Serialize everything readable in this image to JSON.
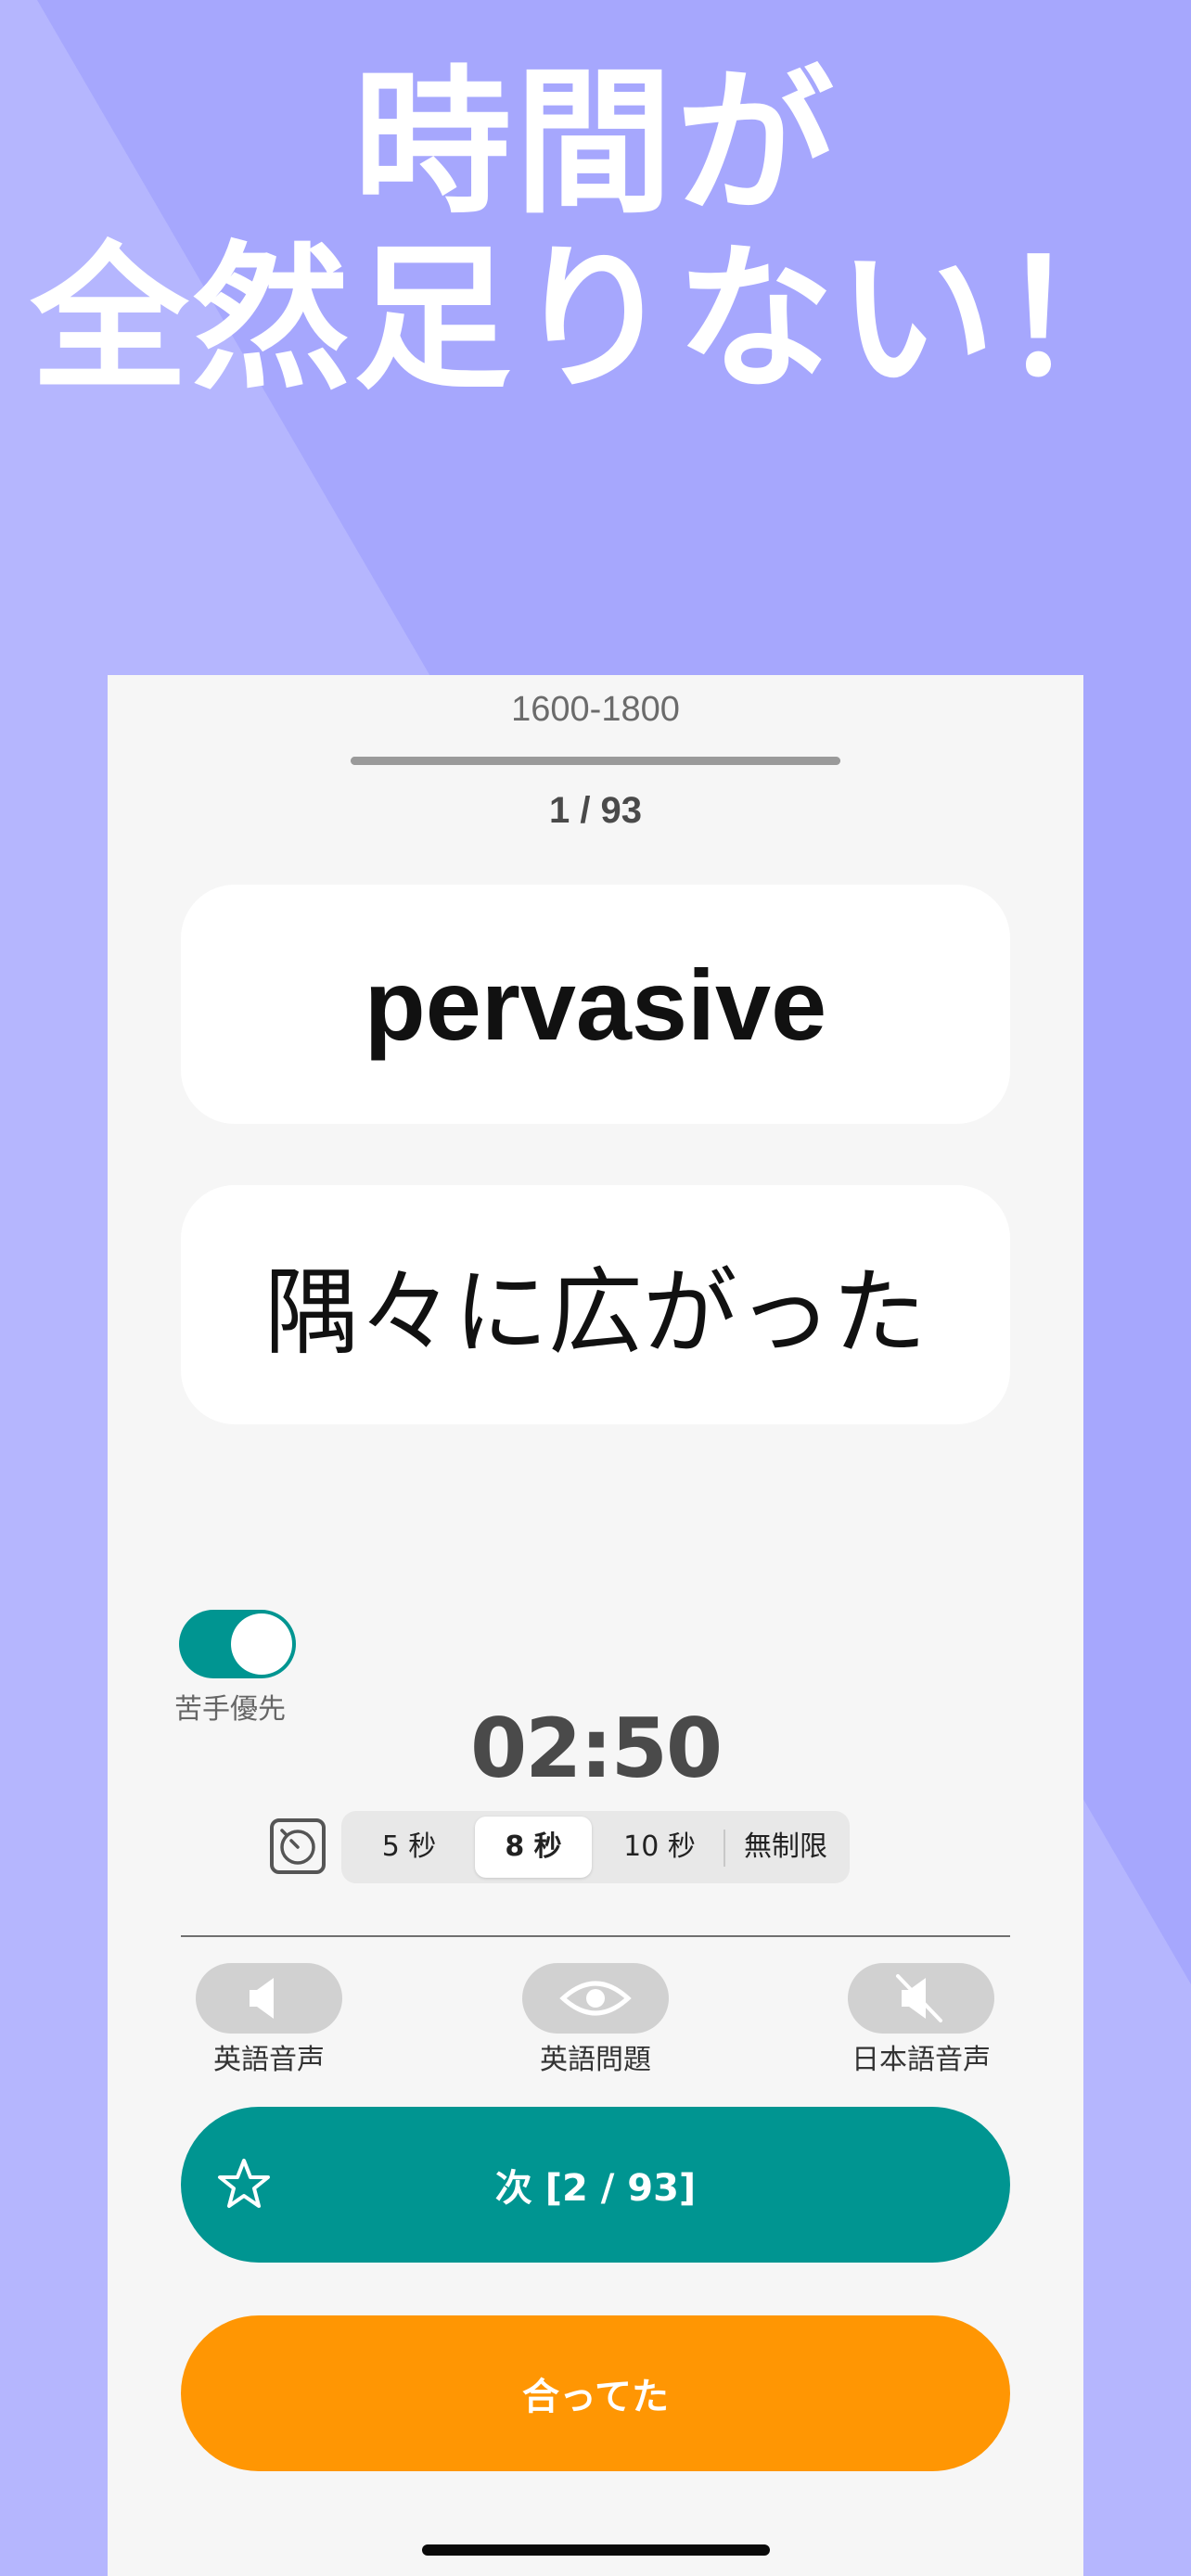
{
  "headline": {
    "line1": "時間が",
    "line2": "全然足りない！"
  },
  "range_label": "1600-1800",
  "progress": {
    "current": 1,
    "total": 93,
    "fraction": 1.0
  },
  "counter": "1 / 93",
  "card": {
    "word": "pervasive",
    "meaning": "隅々に広がった"
  },
  "toggle": {
    "label": "苦手優先",
    "on": true
  },
  "timer": "02:50",
  "timer_options": [
    {
      "label": "5 秒"
    },
    {
      "label": "8 秒",
      "selected": true
    },
    {
      "label": "10 秒"
    },
    {
      "label": "無制限"
    }
  ],
  "audio_controls": [
    {
      "label": "英語音声",
      "icon": "speaker-icon"
    },
    {
      "label": "英語問題",
      "icon": "eye-icon"
    },
    {
      "label": "日本語音声",
      "icon": "speaker-muted-icon"
    }
  ],
  "buttons": {
    "next_label": "次 [2 / 93]",
    "correct_label": "合ってた"
  },
  "colors": {
    "teal": "#009591",
    "orange": "#ff9603",
    "background": "#a6a7fd"
  }
}
